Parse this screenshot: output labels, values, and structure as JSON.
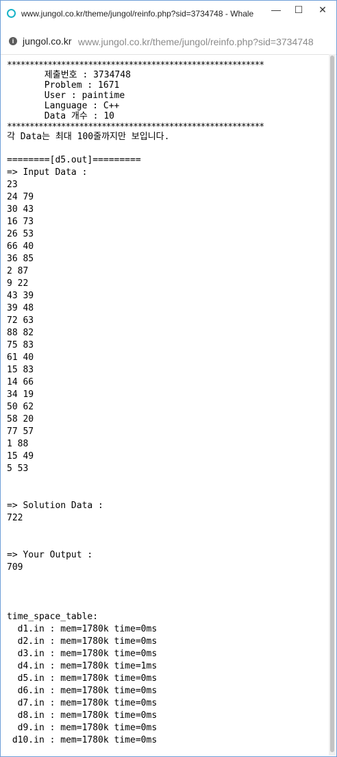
{
  "window": {
    "title": "www.jungol.co.kr/theme/jungol/reinfo.php?sid=3734748 - Whale",
    "minimize": "—",
    "maximize": "☐",
    "close": "✕"
  },
  "address_bar": {
    "host": "jungol.co.kr",
    "url": "www.jungol.co.kr/theme/jungol/reinfo.php?sid=3734748"
  },
  "header": {
    "border": "*********************************************************",
    "submission": "       제출번호 : 3734748",
    "problem": "       Problem : 1671",
    "user": "       User : paintime",
    "language": "       Language : C++",
    "data_count": "       Data 개수 : 10",
    "notice": "각 Data는 최대 100줄까지만 보입니다."
  },
  "case": {
    "banner": "========[d5.out]=========",
    "input_heading": "=> Input Data :",
    "input_lines": [
      "23",
      "24 79",
      "30 43",
      "16 73",
      "26 53",
      "66 40",
      "36 85",
      "2 87",
      "9 22",
      "43 39",
      "39 48",
      "72 63",
      "88 82",
      "75 83",
      "61 40",
      "15 83",
      "14 66",
      "34 19",
      "50 62",
      "58 20",
      "77 57",
      "1 88",
      "15 49",
      "5 53"
    ],
    "solution_heading": "=> Solution Data :",
    "solution_value": "722",
    "output_heading": "=> Your Output :",
    "output_value": "709"
  },
  "time_space": {
    "heading": "time_space_table:",
    "rows": [
      "  d1.in : mem=1780k time=0ms",
      "  d2.in : mem=1780k time=0ms",
      "  d3.in : mem=1780k time=0ms",
      "  d4.in : mem=1780k time=1ms",
      "  d5.in : mem=1780k time=0ms",
      "  d6.in : mem=1780k time=0ms",
      "  d7.in : mem=1780k time=0ms",
      "  d8.in : mem=1780k time=0ms",
      "  d9.in : mem=1780k time=0ms",
      " d10.in : mem=1780k time=0ms"
    ]
  }
}
